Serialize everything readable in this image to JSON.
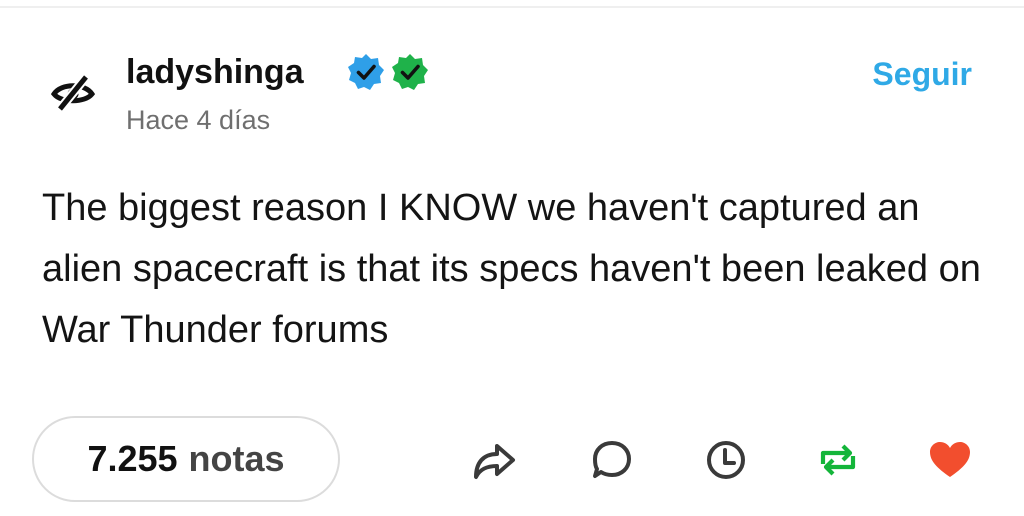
{
  "post": {
    "username": "ladyshinga",
    "timestamp": "Hace 4 días",
    "follow_label": "Seguir",
    "body": "The biggest reason I KNOW we haven't captured an alien spacecraft is that its specs haven't been leaked on War Thunder forums"
  },
  "footer": {
    "notes_count": "7.255",
    "notes_label": "notas"
  },
  "colors": {
    "follow": "#2fa9e6",
    "badge_blue": "#2f9fe8",
    "badge_green": "#1fb24a",
    "reblog": "#14b53a",
    "like": "#f24e2e"
  },
  "icons": {
    "avatar": "crossed-eye-icon",
    "badges": [
      "blue-checkmark-badge-icon",
      "green-checkmark-badge-icon"
    ],
    "actions": [
      "share-icon",
      "reply-icon",
      "history-icon",
      "reblog-icon",
      "heart-icon"
    ]
  }
}
